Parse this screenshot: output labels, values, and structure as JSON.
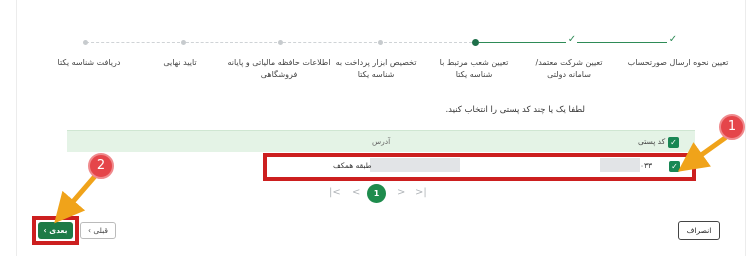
{
  "stepper": {
    "steps": [
      {
        "label": "تعیین نحوه ارسال صورتحساب",
        "state": "done"
      },
      {
        "label": "تعیین شرکت معتمد/سامانه دولتی",
        "state": "done"
      },
      {
        "label": "تعیین شعب مرتبط با شناسه یکتا",
        "state": "current"
      },
      {
        "label": "تخصیص ابزار پرداخت به شناسه یکتا",
        "state": "pending"
      },
      {
        "label": "اطلاعات حافظه مالیاتی و پایانه فروشگاهی",
        "state": "pending"
      },
      {
        "label": "تایید نهایی",
        "state": "pending"
      },
      {
        "label": "دریافت شناسه یکتا",
        "state": "pending"
      }
    ]
  },
  "instruction": "لطفا یک یا چند کد پستی را انتخاب کنید.",
  "table": {
    "columns": {
      "postal_code": "کد پستی",
      "address": "آدرس"
    },
    "rows": [
      {
        "postal_code_suffix": "۰۳۳",
        "address_text": "طبقه همکف",
        "selected": true
      }
    ]
  },
  "pagination": {
    "current_page": "1",
    "first_icon": "first-page-icon",
    "prev_icon": "prev-page-icon",
    "next_icon": "next-page-icon",
    "last_icon": "last-page-icon"
  },
  "buttons": {
    "cancel": "انصراف",
    "prev": "قبلی",
    "next": "بعدی"
  },
  "annotations": {
    "badge1": "1",
    "badge2": "2"
  },
  "colors": {
    "accent_green": "#1e8c4d",
    "header_bg": "#e4f3e6",
    "highlight_red": "#cc1f1f",
    "arrow_orange": "#f0a31a",
    "badge_red": "#e5454a"
  }
}
